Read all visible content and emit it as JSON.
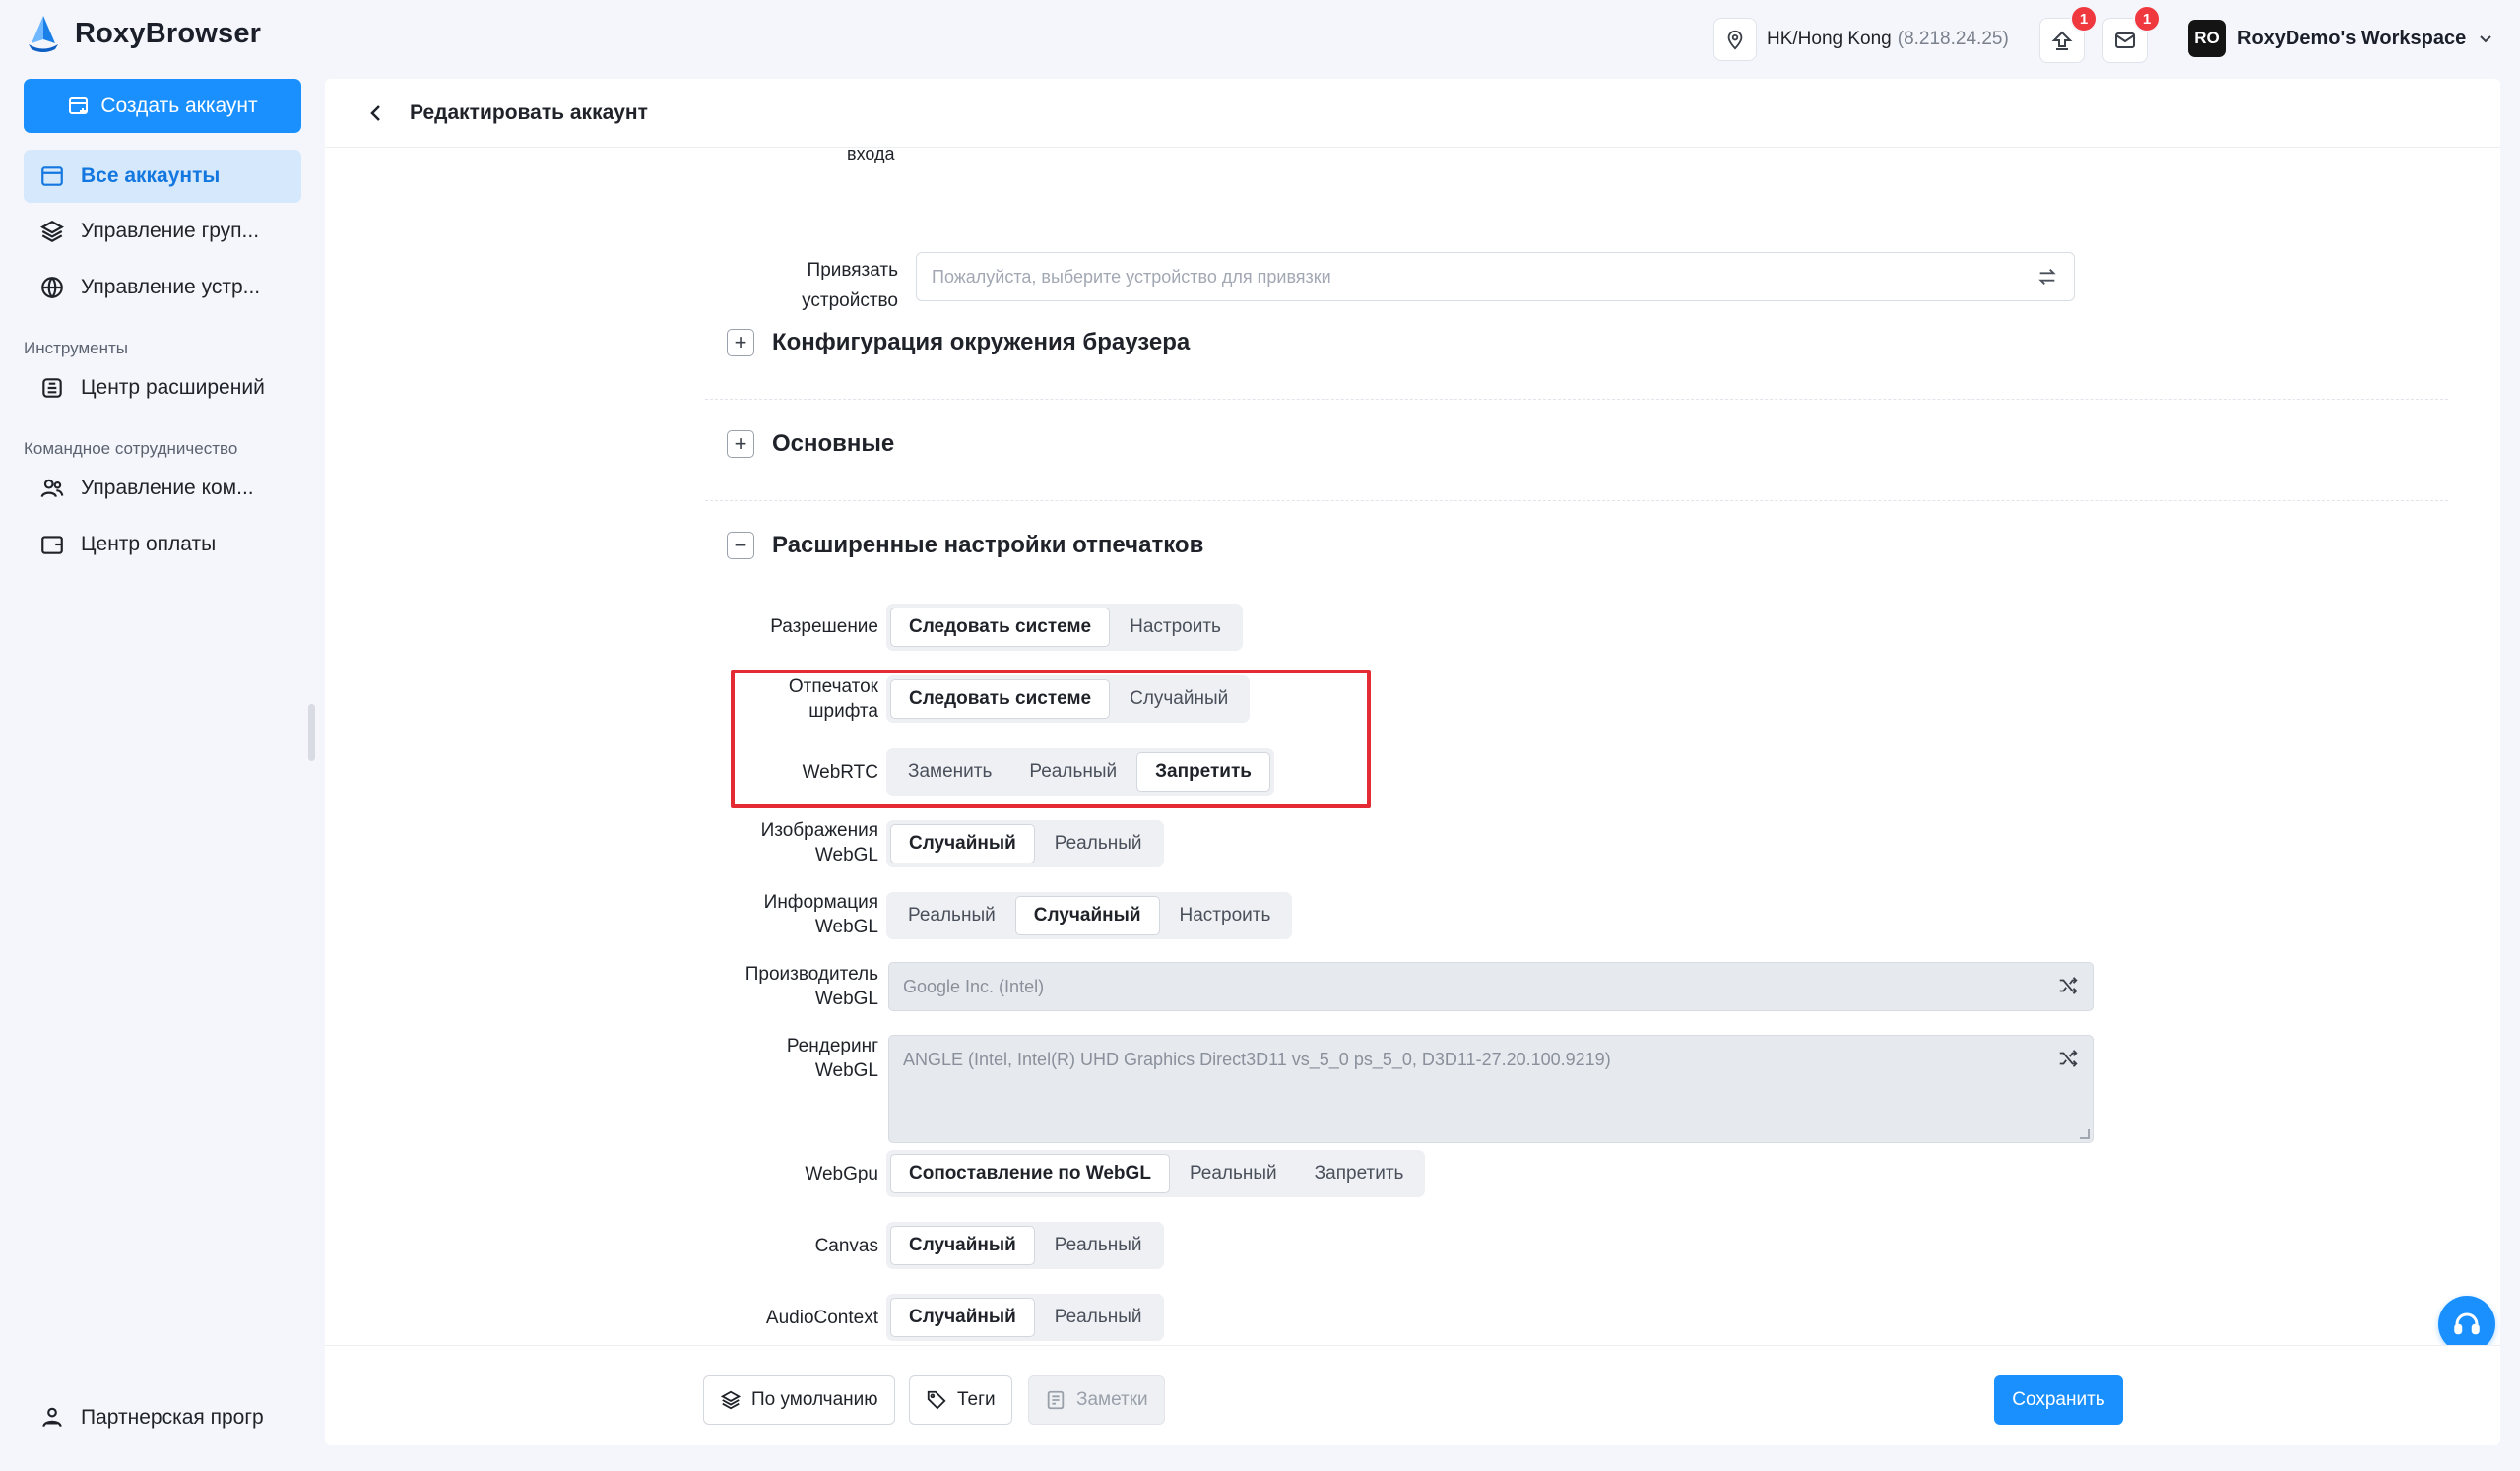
{
  "app": {
    "name": "RoxyBrowser"
  },
  "header": {
    "location": {
      "region": "HK/Hong Kong",
      "ip": "(8.218.24.25)"
    },
    "upload_badge": "1",
    "mail_badge": "1",
    "workspace": {
      "initials": "RO",
      "name": "RoxyDemo's Workspace"
    }
  },
  "sidebar": {
    "create_label": "Создать аккаунт",
    "items": [
      {
        "label": "Все аккаунты"
      },
      {
        "label": "Управление груп..."
      },
      {
        "label": "Управление устр..."
      }
    ],
    "section_tools": "Инструменты",
    "tools": [
      {
        "label": "Центр расширений"
      }
    ],
    "section_team": "Командное сотрудничество",
    "team": [
      {
        "label": "Управление ком..."
      },
      {
        "label": "Центр оплаты"
      }
    ],
    "partner_label": "Партнерская прогр"
  },
  "panel": {
    "title": "Редактировать аккаунт",
    "clipped_label": "входа",
    "bind_device": {
      "label_line1": "Привязать",
      "label_line2": "устройство",
      "placeholder": "Пожалуйста, выберите устройство для привязки"
    },
    "sections": {
      "browser_env": "Конфигурация окружения браузера",
      "basic": "Основные",
      "advanced": "Расширенные настройки отпечатков"
    },
    "fields": {
      "resolution": {
        "label": "Разрешение",
        "options": [
          "Следовать системе",
          "Настроить"
        ],
        "selected": "Следовать системе"
      },
      "font": {
        "label_line1": "Отпечаток",
        "label_line2": "шрифта",
        "options": [
          "Следовать системе",
          "Случайный"
        ],
        "selected": "Следовать системе"
      },
      "webrtc": {
        "label": "WebRTC",
        "options": [
          "Заменить",
          "Реальный",
          "Запретить"
        ],
        "selected": "Запретить"
      },
      "webgl_images": {
        "label_line1": "Изображения",
        "label_line2": "WebGL",
        "options": [
          "Случайный",
          "Реальный"
        ],
        "selected": "Случайный"
      },
      "webgl_info": {
        "label_line1": "Информация",
        "label_line2": "WebGL",
        "options": [
          "Реальный",
          "Случайный",
          "Настроить"
        ],
        "selected": "Случайный"
      },
      "webgl_vendor": {
        "label_line1": "Производитель",
        "label_line2": "WebGL",
        "value": "Google Inc. (Intel)"
      },
      "webgl_render": {
        "label_line1": "Рендеринг",
        "label_line2": "WebGL",
        "value": "ANGLE (Intel, Intel(R) UHD Graphics Direct3D11 vs_5_0 ps_5_0, D3D11-27.20.100.9219)"
      },
      "webgpu": {
        "label": "WebGpu",
        "options": [
          "Сопоставление по WebGL",
          "Реальный",
          "Запретить"
        ],
        "selected": "Сопоставление по WebGL"
      },
      "canvas": {
        "label": "Canvas",
        "options": [
          "Случайный",
          "Реальный"
        ],
        "selected": "Случайный"
      },
      "audio": {
        "label": "AudioContext",
        "options": [
          "Случайный",
          "Реальный"
        ],
        "selected": "Случайный"
      }
    },
    "footer": {
      "default_label": "По умолчанию",
      "tags_label": "Теги",
      "notes_label": "Заметки",
      "save_label": "Сохранить"
    }
  },
  "colors": {
    "accent": "#1a90ff",
    "highlight": "#e42b33",
    "badge": "#f0383f"
  }
}
